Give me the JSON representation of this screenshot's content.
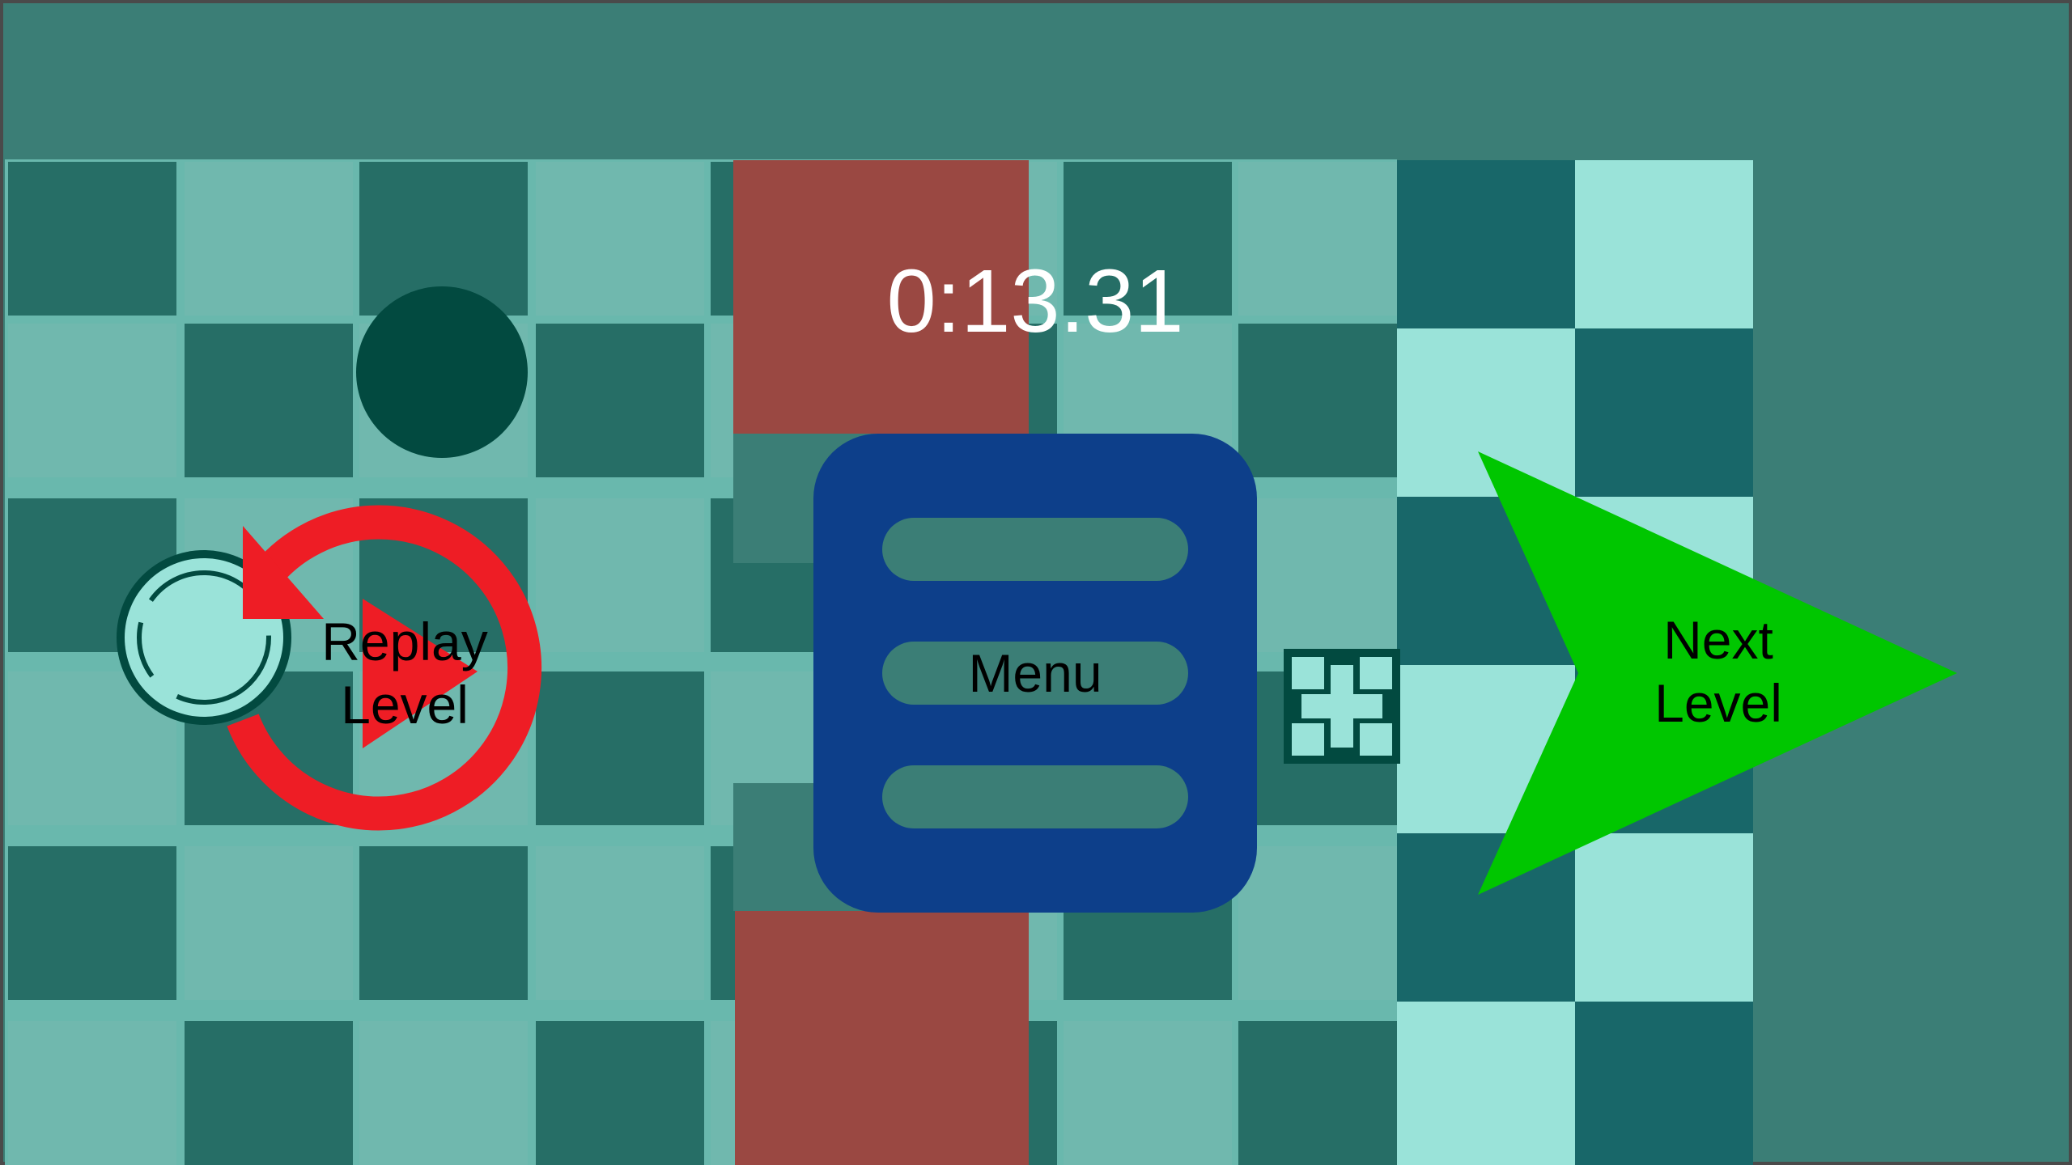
{
  "timer": {
    "value": "0:13.31"
  },
  "buttons": {
    "replay": {
      "line1": "Replay",
      "line2": "Level",
      "icon": "replay-arrow-icon"
    },
    "menu": {
      "label": "Menu",
      "icon": "hamburger-menu-icon"
    },
    "next": {
      "line1": "Next",
      "line2": "Level",
      "icon": "next-arrow-icon"
    }
  },
  "game_pieces": {
    "player": "player-ring-piece",
    "target": "dark-circle-target",
    "collectible": "plus-tile-icon"
  },
  "colors": {
    "background": "#3b7e76",
    "board_frame": "#69b8ad",
    "tile_dark": "#266e66",
    "tile_light": "#70b8ae",
    "panel_dark": "#186769",
    "panel_light": "#9ae3d9",
    "red_blocker": "#9a4842",
    "menu_blue": "#0d3f8a",
    "replay_red": "#ee1d25",
    "next_green": "#00c600",
    "dark_piece": "#024a40",
    "timer_text": "#ffffff"
  }
}
